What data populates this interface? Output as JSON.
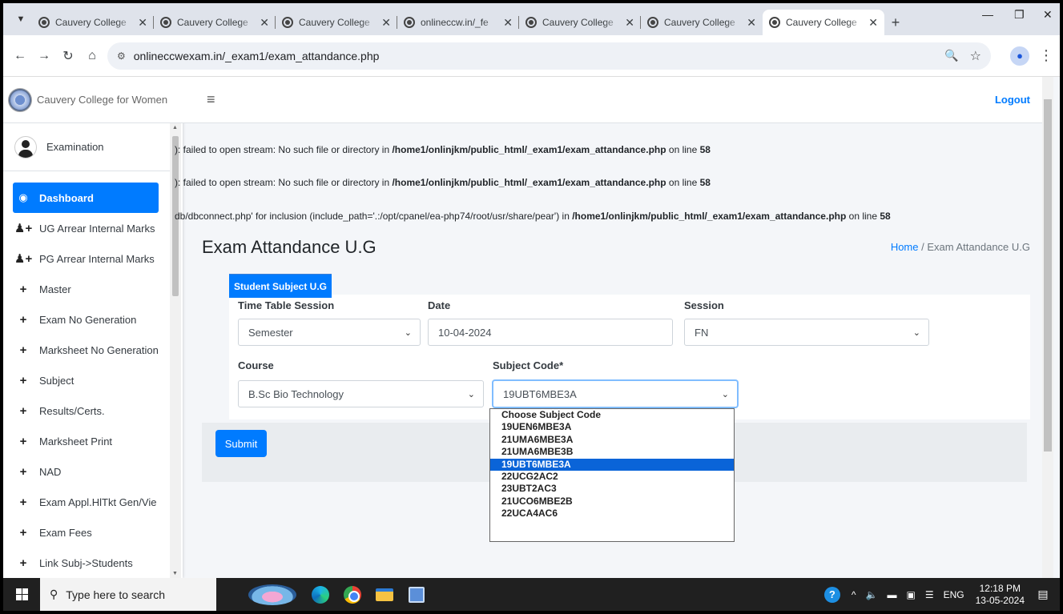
{
  "browser": {
    "tabs": [
      {
        "label": "Cauvery College"
      },
      {
        "label": "Cauvery College"
      },
      {
        "label": "Cauvery College"
      },
      {
        "label": "onlineccw.in/_fe"
      },
      {
        "label": "Cauvery College"
      },
      {
        "label": "Cauvery College"
      },
      {
        "label": "Cauvery College"
      }
    ],
    "url": "onlineccwexam.in/_exam1/exam_attandance.php"
  },
  "sidebar": {
    "brand": "Cauvery College for Women",
    "user": "Examination",
    "items": [
      {
        "label": "Dashboard",
        "icon": "dashboard-icon"
      },
      {
        "label": "UG Arrear Internal Marks",
        "icon": "user-plus-icon"
      },
      {
        "label": "PG Arrear Internal Marks",
        "icon": "user-plus-icon"
      },
      {
        "label": "Master",
        "icon": "plus-icon"
      },
      {
        "label": "Exam No Generation",
        "icon": "plus-icon"
      },
      {
        "label": "Marksheet No Generation",
        "icon": "plus-icon"
      },
      {
        "label": "Subject",
        "icon": "plus-icon"
      },
      {
        "label": "Results/Certs.",
        "icon": "plus-icon"
      },
      {
        "label": "Marksheet Print",
        "icon": "plus-icon"
      },
      {
        "label": "NAD",
        "icon": "plus-icon"
      },
      {
        "label": "Exam Appl.HlTkt Gen/Vie",
        "icon": "plus-icon"
      },
      {
        "label": "Exam Fees",
        "icon": "plus-icon"
      },
      {
        "label": "Link Subj->Students",
        "icon": "plus-icon"
      }
    ]
  },
  "header": {
    "logout": "Logout"
  },
  "warnings": [
    {
      "text": "): failed to open stream: No such file or directory in ",
      "path": "/home1/onlinjkm/public_html/_exam1/exam_attandance.php",
      "online": " on line ",
      "line": "58"
    },
    {
      "text": "): failed to open stream: No such file or directory in ",
      "path": "/home1/onlinjkm/public_html/_exam1/exam_attandance.php",
      "online": " on line ",
      "line": "58"
    },
    {
      "text": "db/dbconnect.php' for inclusion (include_path='.:/opt/cpanel/ea-php74/root/usr/share/pear') in ",
      "path": "/home1/onlinjkm/public_html/_exam1/exam_attandance.php",
      "online": " on line ",
      "line": "58"
    }
  ],
  "page": {
    "title": "Exam Attandance U.G",
    "breadcrumb_home": "Home",
    "breadcrumb_sep": "/",
    "breadcrumb_current": "Exam Attandance U.G"
  },
  "form": {
    "card_tab": "Student Subject U.G",
    "time_table_label": "Time Table Session",
    "time_table_value": "Semester",
    "date_label": "Date",
    "date_value": "10-04-2024",
    "session_label": "Session",
    "session_value": "FN",
    "course_label": "Course",
    "course_value": "B.Sc Bio Technology",
    "subject_label": "Subject Code*",
    "subject_value": "19UBT6MBE3A",
    "submit": "Submit",
    "subject_options": [
      "Choose Subject Code",
      "19UEN6MBE3A",
      "21UMA6MBE3A",
      "21UMA6MBE3B",
      "19UBT6MBE3A",
      "22UCG2AC2",
      "23UBT2AC3",
      "21UCO6MBE2B",
      "22UCA4AC6"
    ],
    "selected_index": 4
  },
  "taskbar": {
    "search_placeholder": "Type here to search",
    "lang": "ENG",
    "time": "12:18 PM",
    "date": "13-05-2024"
  }
}
